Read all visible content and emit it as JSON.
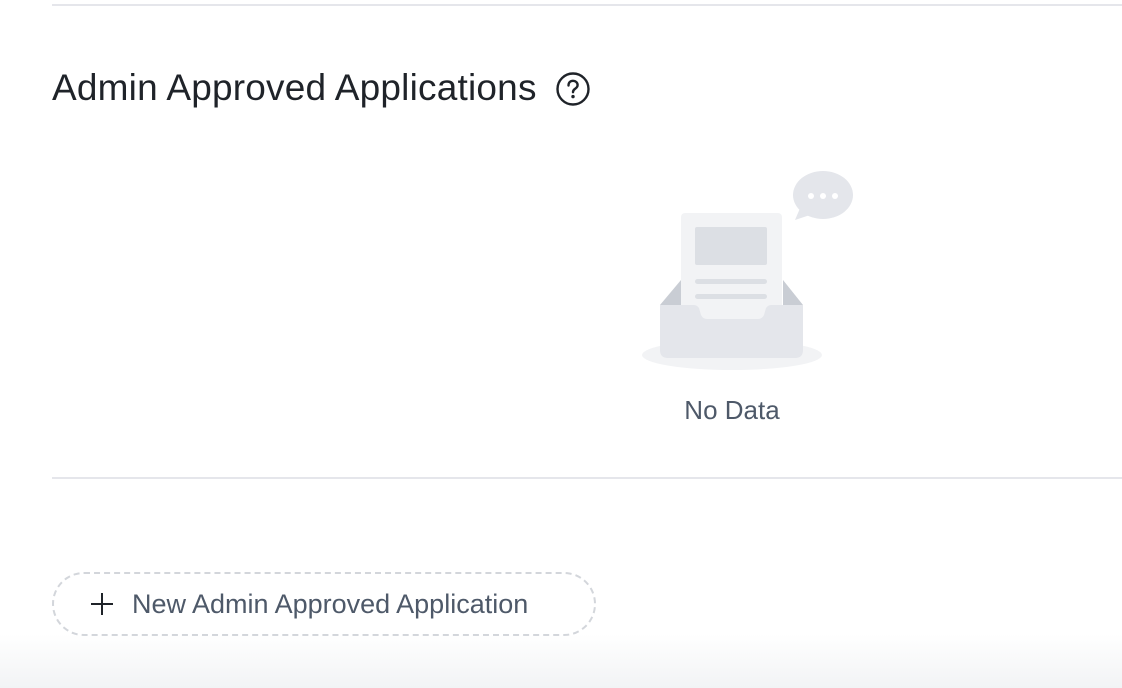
{
  "section": {
    "title": "Admin Approved Applications",
    "help_icon": "question-circle-icon"
  },
  "empty_state": {
    "illustration": "empty-inbox-illustration",
    "text": "No Data"
  },
  "actions": {
    "new_button_icon": "plus-icon",
    "new_button_label": "New Admin Approved Application"
  },
  "colors": {
    "title_text": "#1f2329",
    "secondary_text": "#4e5969",
    "divider": "#e5e6eb",
    "dashed_border": "#d3d6db",
    "illustration_fill": "#e4e6eb"
  }
}
